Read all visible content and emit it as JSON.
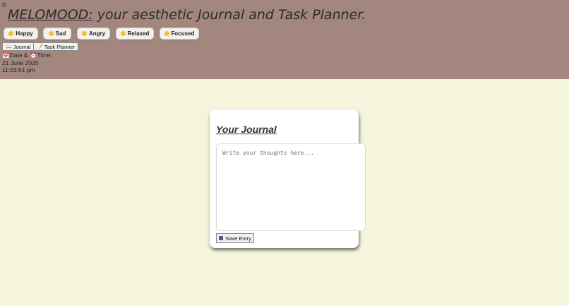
{
  "header": {
    "corner_digit": "0",
    "brand": "MELOMOOD:",
    "tagline": " your aesthetic Journal and Task Planner."
  },
  "moods": [
    {
      "label": "Happy"
    },
    {
      "label": "Sad"
    },
    {
      "label": "Angry"
    },
    {
      "label": "Relaxed"
    },
    {
      "label": "Focused"
    }
  ],
  "tabs": [
    {
      "label": "Journal",
      "icon": "book-icon"
    },
    {
      "label": "Task Planner",
      "icon": "notepad-icon"
    }
  ],
  "datetime": {
    "label_date": "Date & ",
    "label_time": "Time:",
    "date": "21 June 2025",
    "time": "11:03:51 pm"
  },
  "journal": {
    "title": "Your Journal",
    "placeholder": "Write your thoughts here...",
    "value": "",
    "save_label": "Save Entry"
  },
  "colors": {
    "header_bg": "#a3877e",
    "page_bg": "#f5f4dc",
    "emoji_yellow": "#f2c12e"
  }
}
